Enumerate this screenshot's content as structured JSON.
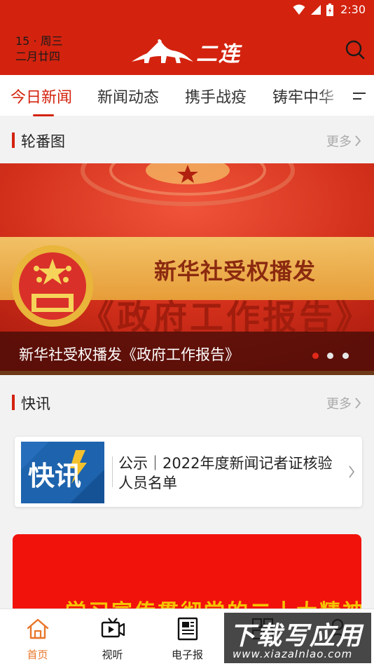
{
  "status_bar": {
    "time": "2:30"
  },
  "header": {
    "date_line1": "15 · 周三",
    "date_line2": "二月廿四",
    "logo_text": "二连",
    "search_icon": "search-icon"
  },
  "tabs": {
    "items": [
      "今日新闻",
      "新闻动态",
      "携手战疫",
      "铸牢中华"
    ],
    "active_index": 0,
    "menu_icon": "menu-icon"
  },
  "carousel_section": {
    "title": "轮番图",
    "more": "更多"
  },
  "carousel": {
    "banner_line1": "新华社受权播发",
    "banner_line2": "《政府工作报告》",
    "caption": "新华社受权播发《政府工作报告》",
    "dot_count": 3,
    "active_dot": 0
  },
  "news_section": {
    "title": "快讯",
    "more": "更多"
  },
  "news_card": {
    "thumb_text": "快讯",
    "title": "公示｜2022年度新闻记者证核验人员名单"
  },
  "red_banner": {
    "text": "学习宣传贯彻党的二十大精神"
  },
  "bottom_nav": {
    "items": [
      {
        "label": "首页",
        "icon": "home-icon"
      },
      {
        "label": "视听",
        "icon": "video-icon"
      },
      {
        "label": "电子报",
        "icon": "newspaper-icon"
      },
      {
        "label": "",
        "icon": "apps-icon"
      },
      {
        "label": "",
        "icon": "user-icon"
      }
    ],
    "active_index": 0
  },
  "watermark": {
    "main": "下载写应用",
    "sub": "www.xiazaInlao.com"
  },
  "colors": {
    "brand_red": "#d3230e",
    "active_nav": "#e8762a",
    "banner_red": "#f1120c",
    "banner_gold": "#f5c400"
  }
}
